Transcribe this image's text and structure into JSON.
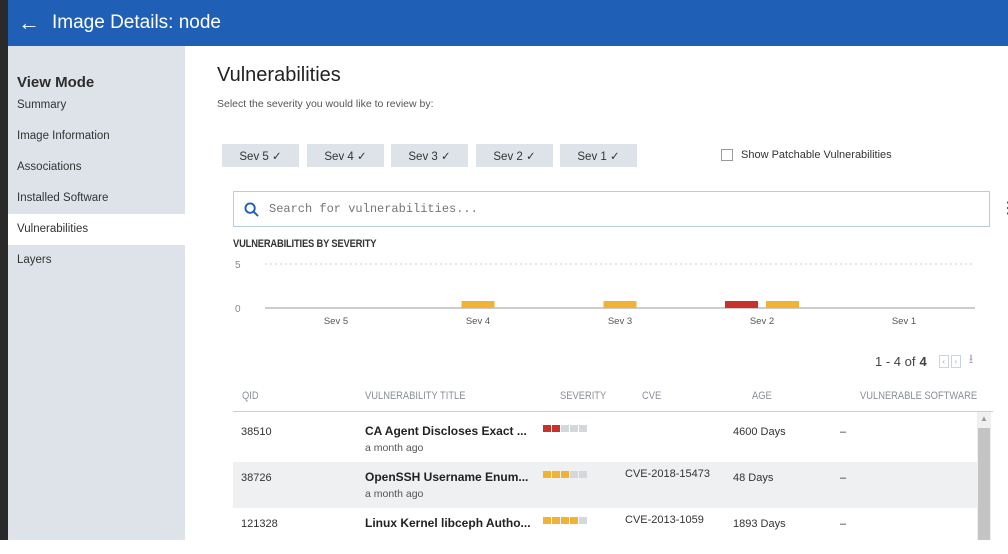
{
  "header": {
    "title": "Image Details: node",
    "back_icon": "arrow-left-icon"
  },
  "sidebar": {
    "title": "View Mode",
    "items": [
      {
        "label": "Summary"
      },
      {
        "label": "Image Information"
      },
      {
        "label": "Associations"
      },
      {
        "label": "Installed Software"
      },
      {
        "label": "Vulnerabilities",
        "active": true
      },
      {
        "label": "Layers"
      }
    ]
  },
  "main": {
    "title": "Vulnerabilities",
    "subtitle": "Select the severity you would like to review by:",
    "severity_filters": [
      {
        "label": "Sev 5 ✓"
      },
      {
        "label": "Sev 4 ✓"
      },
      {
        "label": "Sev 3 ✓"
      },
      {
        "label": "Sev 2 ✓"
      },
      {
        "label": "Sev 1 ✓"
      }
    ],
    "patchable_label": "Show Patchable Vulnerabilities",
    "patchable_checked": false,
    "search_placeholder": "Search for vulnerabilities...",
    "chart_title": "VULNERABILITIES BY SEVERITY",
    "pager": {
      "range": "1 - 4 of",
      "total": "4"
    },
    "columns": [
      "QID",
      "VULNERABILITY TITLE",
      "SEVERITY",
      "CVE",
      "AGE",
      "VULNERABLE SOFTWARE"
    ],
    "rows": [
      {
        "qid": "38510",
        "title": "CA Agent Discloses Exact ...",
        "ago": "a month ago",
        "severity": 2,
        "cve": "",
        "age": "4600 Days",
        "software": "–"
      },
      {
        "qid": "38726",
        "title": "OpenSSH Username Enum...",
        "ago": "a month ago",
        "severity": 3,
        "cve": "CVE-2018-15473",
        "age": "48 Days",
        "software": "–"
      },
      {
        "qid": "121328",
        "title": "Linux Kernel libceph Autho...",
        "ago": "",
        "severity": 4,
        "cve": "CVE-2013-1059",
        "age": "1893 Days",
        "software": "–"
      }
    ]
  },
  "colors": {
    "header": "#1f5fb6",
    "sev_high": "#c8322a",
    "sev_med": "#f2b233",
    "sev_empty": "#d4d7db"
  },
  "chart_data": {
    "type": "bar",
    "title": "VULNERABILITIES BY SEVERITY",
    "categories": [
      "Sev 5",
      "Sev 4",
      "Sev 3",
      "Sev 2",
      "Sev 1"
    ],
    "series": [
      {
        "values": [
          0,
          0,
          0,
          1,
          0
        ],
        "color": "#c8322a"
      },
      {
        "values": [
          0,
          1,
          1,
          1,
          0
        ],
        "color": "#f2b233"
      }
    ],
    "ylim": [
      0,
      5
    ],
    "yticks": [
      "5",
      "0"
    ],
    "grid": true
  }
}
